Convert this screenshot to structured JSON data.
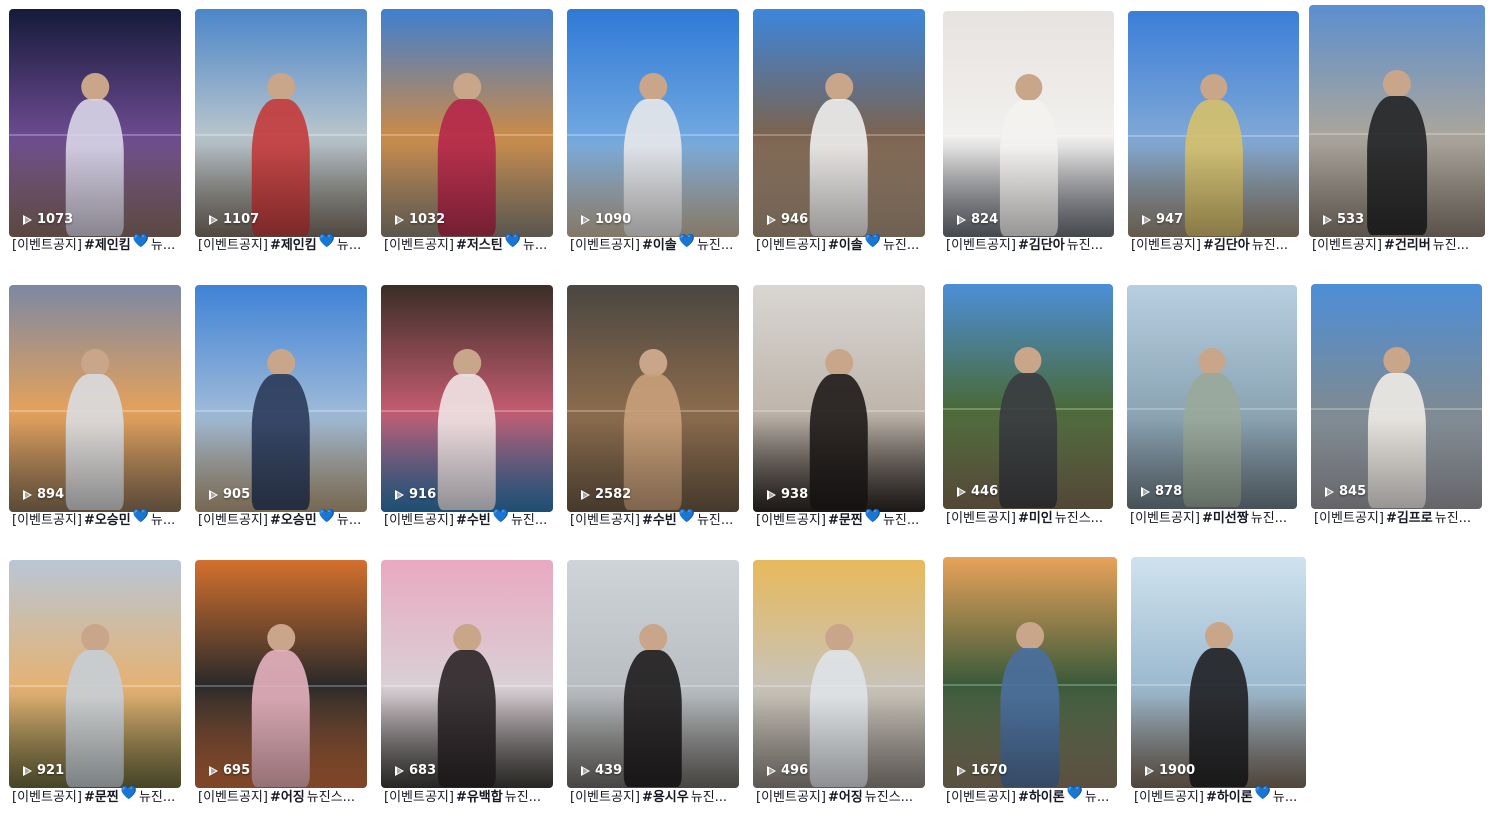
{
  "videos": [
    {
      "views": "1073",
      "prefix": "[이벤트공지]",
      "tag": "#제인킴",
      "heart": "💙",
      "suffix": "뉴...",
      "colors": [
        "#151a3a",
        "#6b4a8f",
        "#8a6e64"
      ],
      "person": "#d9d6e8"
    },
    {
      "views": "1107",
      "prefix": "[이벤트공지]",
      "tag": "#제인킴",
      "heart": "💙",
      "suffix": "뉴...",
      "colors": [
        "#4b86c9",
        "#b7c4cc",
        "#7b7064"
      ],
      "person": "#c43a3a"
    },
    {
      "views": "1032",
      "prefix": "[이벤트공지]",
      "tag": "#저스틴",
      "heart": "💙",
      "suffix": "뉴...",
      "colors": [
        "#3f7fd0",
        "#c98a4a",
        "#8c8476"
      ],
      "person": "#b5274a"
    },
    {
      "views": "1090",
      "prefix": "[이벤트공지]",
      "tag": "#이솔",
      "heart": "💙",
      "suffix": "뉴진...",
      "colors": [
        "#2f79d6",
        "#6fa7e0",
        "#c9b79e"
      ],
      "person": "#e8e8ea"
    },
    {
      "views": "946",
      "prefix": "[이벤트공지]",
      "tag": "#이솔",
      "heart": "💙",
      "suffix": "뉴진...",
      "colors": [
        "#3c86dc",
        "#7b6350",
        "#a8937c"
      ],
      "person": "#eeeeee"
    },
    {
      "views": "824",
      "prefix": "[이벤트공지]",
      "tag": "#김단아",
      "heart": "",
      "suffix": "뉴진...",
      "colors": [
        "#e6e3e0",
        "#f2f0ee",
        "#6b6f78"
      ],
      "person": "#f4f2ef"
    },
    {
      "views": "947",
      "prefix": "[이벤트공지]",
      "tag": "#김단아",
      "heart": "",
      "suffix": "뉴진...",
      "colors": [
        "#3b7ed8",
        "#7ea7d6",
        "#9a8a74"
      ],
      "person": "#d6c06a"
    },
    {
      "views": "533",
      "prefix": "[이벤트공지]",
      "tag": "#건리버",
      "heart": "",
      "suffix": "뉴진...",
      "colors": [
        "#5b8fcf",
        "#a9a59d",
        "#8a7f73"
      ],
      "person": "#222426"
    },
    {
      "views": "894",
      "prefix": "[이벤트공지]",
      "tag": "#오승민",
      "heart": "💙",
      "suffix": "뉴...",
      "colors": [
        "#7d88a3",
        "#e3a15c",
        "#8b7256"
      ],
      "person": "#d9dbe0"
    },
    {
      "views": "905",
      "prefix": "[이벤트공지]",
      "tag": "#오승민",
      "heart": "💙",
      "suffix": "뉴...",
      "colors": [
        "#3f82d6",
        "#9bb8d8",
        "#b59e7c"
      ],
      "person": "#2a3a5a"
    },
    {
      "views": "916",
      "prefix": "[이벤트공지]",
      "tag": "#수빈",
      "heart": "💙",
      "suffix": "뉴진...",
      "colors": [
        "#3a2e26",
        "#c25b6f",
        "#2d78b0"
      ],
      "person": "#efe4e6"
    },
    {
      "views": "2582",
      "prefix": "[이벤트공지]",
      "tag": "#수빈",
      "heart": "💙",
      "suffix": "뉴진...",
      "colors": [
        "#4a4642",
        "#8a6b4c",
        "#6b5844"
      ],
      "person": "#c9a07a"
    },
    {
      "views": "938",
      "prefix": "[이벤트공지]",
      "tag": "#문찐",
      "heart": "💙",
      "suffix": "뉴진...",
      "colors": [
        "#d9d6d3",
        "#bfb6ac",
        "#2a2422"
      ],
      "person": "#1f1b1a"
    },
    {
      "views": "446",
      "prefix": "[이벤트공지]",
      "tag": "#미인",
      "heart": "",
      "suffix": "뉴진스...",
      "colors": [
        "#4c8fd8",
        "#4a6a3a",
        "#7c6c52"
      ],
      "person": "#3a3c40"
    },
    {
      "views": "878",
      "prefix": "[이벤트공지]",
      "tag": "#미선짱",
      "heart": "",
      "suffix": "뉴진...",
      "colors": [
        "#b7cfe0",
        "#8da6b6",
        "#6e7d86"
      ],
      "person": "#9aa89a"
    },
    {
      "views": "845",
      "prefix": "[이벤트공지]",
      "tag": "#김프로",
      "heart": "",
      "suffix": "뉴진...",
      "colors": [
        "#4c8ed8",
        "#7d8a94",
        "#9a9aa0"
      ],
      "person": "#f0ebe6"
    },
    {
      "views": "921",
      "prefix": "[이벤트공지]",
      "tag": "#문찐",
      "heart": "💙",
      "suffix": "뉴진...",
      "colors": [
        "#b9c6d6",
        "#e4b274",
        "#6a6a3c"
      ],
      "person": "#c7ced6"
    },
    {
      "views": "695",
      "prefix": "[이벤트공지]",
      "tag": "#어징",
      "heart": "",
      "suffix": "뉴진스...",
      "colors": [
        "#d4702e",
        "#2a2a2a",
        "#c46a3a"
      ],
      "person": "#e6b2c0"
    },
    {
      "views": "683",
      "prefix": "[이벤트공지]",
      "tag": "#유백합",
      "heart": "",
      "suffix": "뉴진...",
      "colors": [
        "#e9a9c1",
        "#d9d0d5",
        "#3b3a36"
      ],
      "person": "#2a2426"
    },
    {
      "views": "439",
      "prefix": "[이벤트공지]",
      "tag": "#용시우",
      "heart": "",
      "suffix": "뉴진...",
      "colors": [
        "#cfd4d8",
        "#b9bec2",
        "#6e6a66"
      ],
      "person": "#1e1c1c"
    },
    {
      "views": "496",
      "prefix": "[이벤트공지]",
      "tag": "#어징",
      "heart": "",
      "suffix": "뉴진스...",
      "colors": [
        "#e7b95c",
        "#c8c3b8",
        "#8c8580"
      ],
      "person": "#dfe3e8"
    },
    {
      "views": "1670",
      "prefix": "[이벤트공지]",
      "tag": "#하이론",
      "heart": "💙",
      "suffix": "뉴...",
      "colors": [
        "#e9a25a",
        "#3a5a3a",
        "#8a7a62"
      ],
      "person": "#4a6fa0"
    },
    {
      "views": "1900",
      "prefix": "[이벤트공지]",
      "tag": "#하이론",
      "heart": "💙",
      "suffix": "뉴...",
      "colors": [
        "#cfe2ee",
        "#9cbad0",
        "#7a6a5a"
      ],
      "person": "#1f1f22"
    }
  ]
}
